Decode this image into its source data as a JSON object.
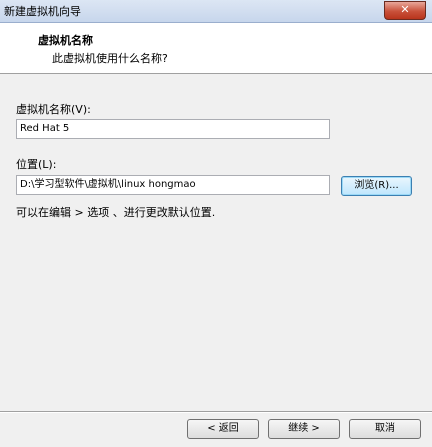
{
  "window": {
    "title": "新建虚拟机向导",
    "close_label": "✕"
  },
  "header": {
    "title": "虚拟机名称",
    "subtitle": "此虚拟机使用什么名称?"
  },
  "name_field": {
    "label": "虚拟机名称(V):",
    "value": "Red Hat  5"
  },
  "location_field": {
    "label": "位置(L):",
    "value": "D:\\学习型软件\\虚拟机\\linux hongmao"
  },
  "browse_label": "浏览(R)...",
  "hint": "可以在编辑 > 选项 、进行更改默认位置.",
  "footer": {
    "back_label": "< 返回",
    "next_label": "继续 >",
    "cancel_label": "取消"
  }
}
